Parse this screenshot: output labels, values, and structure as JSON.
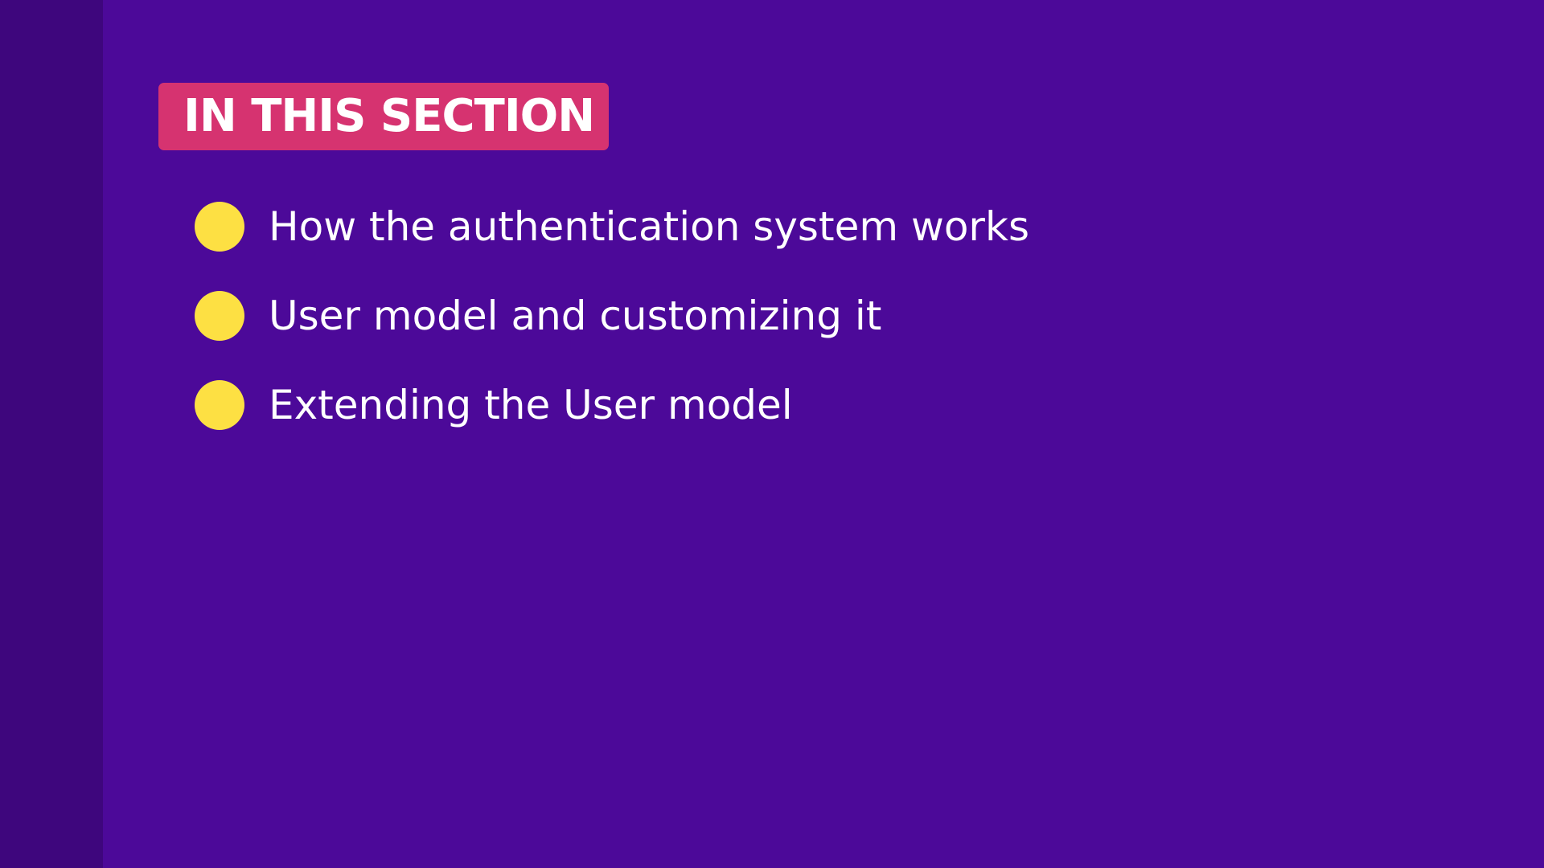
{
  "slide": {
    "heading": "IN THIS SECTION",
    "bullets": [
      "How the authentication system works",
      "User model and customizing it",
      "Extending the User model"
    ]
  },
  "colors": {
    "background": "#4c0999",
    "side_strip": "#3e067d",
    "badge": "#d63370",
    "bullet": "#fde043",
    "text": "#ffffff"
  },
  "icons": {
    "bullet": "bullet-dot-icon"
  }
}
